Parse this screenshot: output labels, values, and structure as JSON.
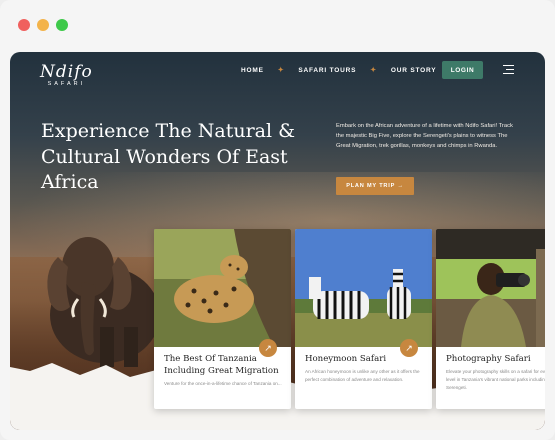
{
  "nav": {
    "logo": "Ndifo",
    "logo_sub": "SAFARI",
    "links": [
      "HOME",
      "SAFARI TOURS",
      "OUR STORY"
    ],
    "login": "LOGIN"
  },
  "hero": {
    "title": "Experience The Natural & Cultural Wonders Of East Africa",
    "description": "Embark on the African adventure of a lifetime with Ndifo Safari! Track the majestic Big Five, explore the Serengeti's plains to witness The Great Migration, trek gorillas, monkeys and chimps in Rwanda.",
    "cta": "PLAN MY TRIP"
  },
  "cards": [
    {
      "title": "The Best Of Tanzania Including Great Migration",
      "text": "Venture for the once-in-a-lifetime chance of Tanzania on..."
    },
    {
      "title": "Honeymoon Safari",
      "text": "An African honeymoon is unlike any other as it offers the perfect combination of adventure and relaxation."
    },
    {
      "title": "Photography Safari",
      "text": "Elevate your photography skills on a safari for every skill level in Tanzania's vibrant national parks including the Serengeti."
    }
  ],
  "icons": {
    "card_arrow": "arrow-up-right-icon",
    "menu": "hamburger-icon"
  },
  "colors": {
    "accent": "#c7873f",
    "login": "#3e7a68"
  }
}
